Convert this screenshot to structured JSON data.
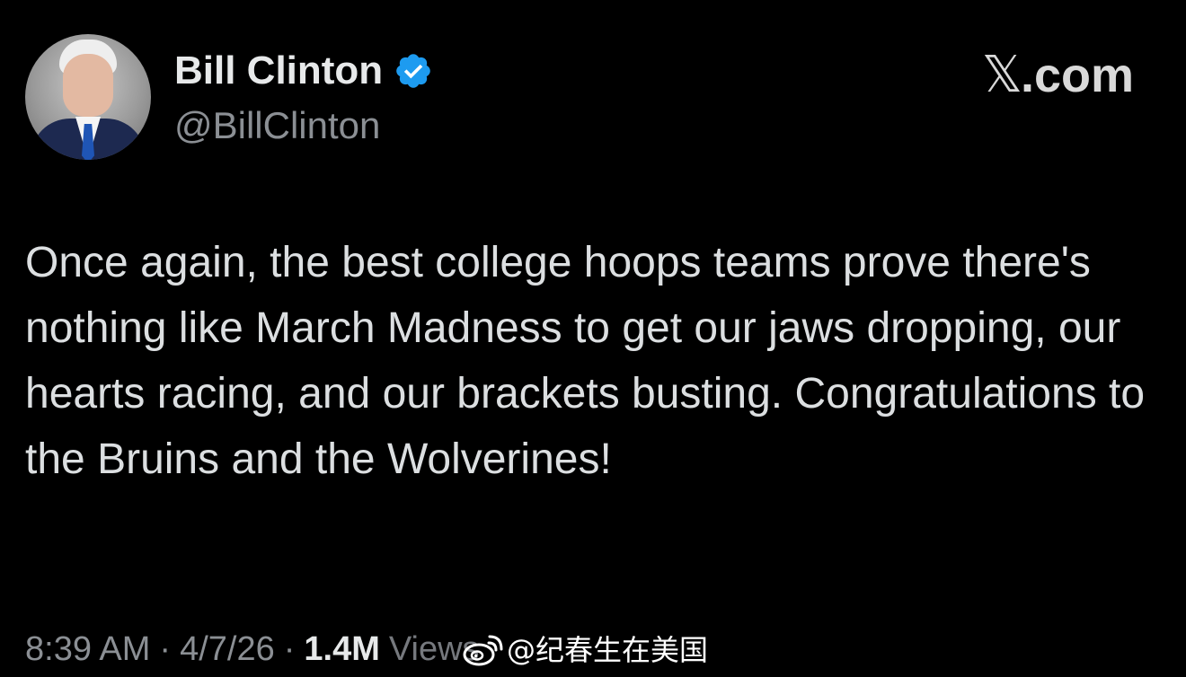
{
  "author": {
    "display_name": "Bill Clinton",
    "handle": "@BillClinton",
    "verified": true,
    "avatar_icon": "profile-photo-avatar"
  },
  "brand": {
    "mark": "𝕏",
    "suffix": ".com"
  },
  "tweet": {
    "text": "Once again, the best college hoops teams prove there's nothing like March Madness to get our jaws dropping, our hearts racing, and our brackets busting. Congratulations to the Bruins and the Wolverines!"
  },
  "meta": {
    "time": "8:39 AM",
    "separator": "·",
    "date": "4/7/26",
    "views_count": "1.4M",
    "views_label": "Views"
  },
  "watermark": {
    "text": "@纪春生在美国",
    "icon": "weibo-logo-icon"
  },
  "colors": {
    "background": "#000000",
    "primary_text": "#e7e9ea",
    "secondary_text": "#8b8f94",
    "verified_badge": "#1d9bf0"
  }
}
